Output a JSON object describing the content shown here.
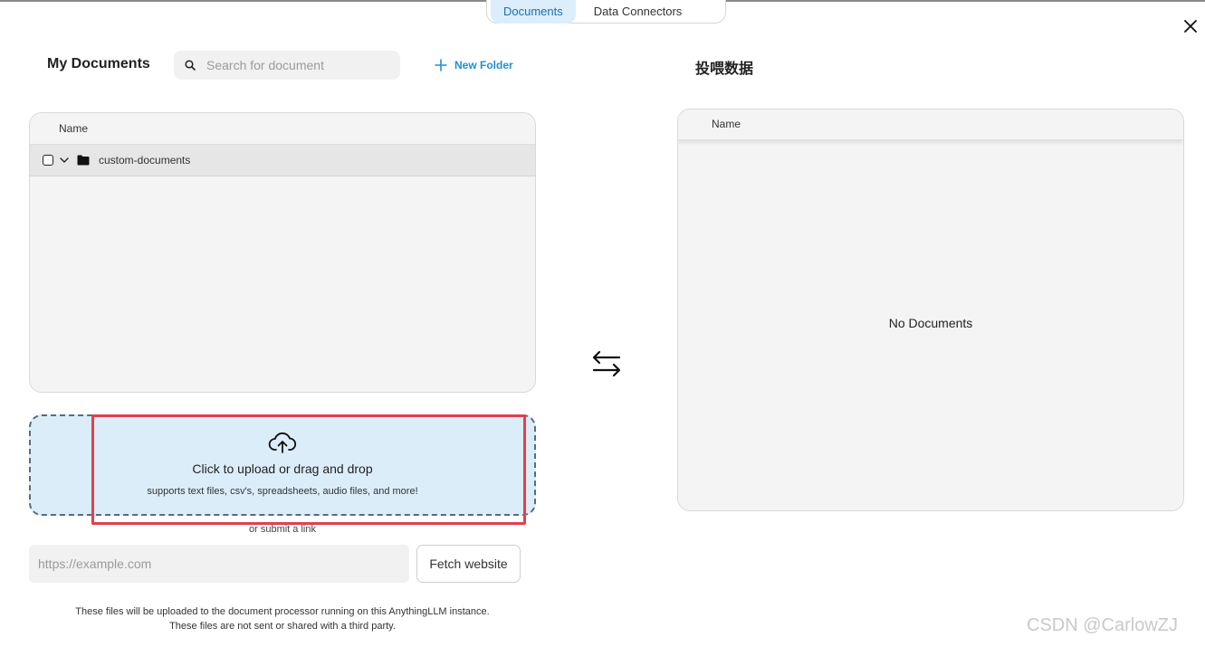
{
  "tabs": [
    {
      "label": "Documents",
      "active": true
    },
    {
      "label": "Data Connectors",
      "active": false
    }
  ],
  "left_panel": {
    "title": "My Documents",
    "search_placeholder": "Search for document",
    "new_folder_label": "New Folder",
    "column_header": "Name",
    "folders": [
      {
        "name": "custom-documents",
        "expanded": false
      }
    ]
  },
  "upload": {
    "title": "Click to upload or drag and drop",
    "subtitle": "supports text files, csv's, spreadsheets, audio files, and more!",
    "or_link": "or submit a link",
    "url_placeholder": "https://example.com",
    "fetch_label": "Fetch website",
    "disclaimer_line1": "These files will be uploaded to the document processor running on this AnythingLLM instance.",
    "disclaimer_line2": "These files are not sent or shared with a third party."
  },
  "right_panel": {
    "title": "投喂数据",
    "column_header": "Name",
    "empty_message": "No Documents"
  },
  "watermark": "CSDN @CarlowZJ",
  "icons": {
    "close": "close-icon",
    "search": "search-icon",
    "plus": "plus-icon",
    "chevron": "chevron-down-icon",
    "folder": "folder-icon",
    "swap": "swap-arrows-icon",
    "upload": "cloud-upload-icon"
  },
  "colors": {
    "accent": "#1e8fd6",
    "active_tab_bg": "#dceefb",
    "drop_zone_bg": "#dcedfa",
    "highlight": "#e2404f"
  }
}
